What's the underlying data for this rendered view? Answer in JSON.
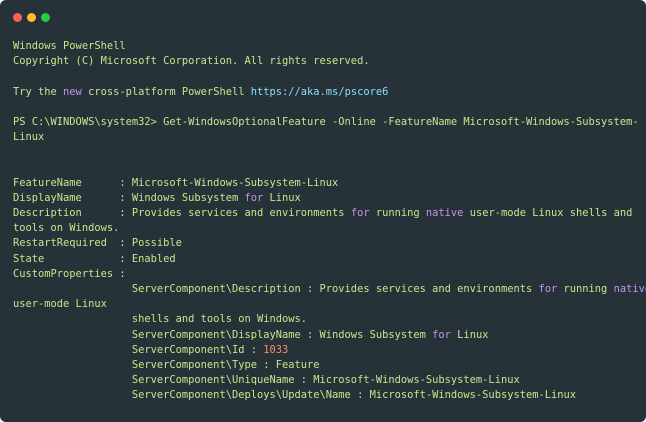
{
  "window": {
    "controls": [
      "close",
      "minimize",
      "maximize"
    ],
    "colors": {
      "background": "#263238",
      "text": "#c3e88d",
      "keyword": "#c792ea",
      "number": "#f78c6c",
      "url": "#89ddff"
    }
  },
  "terminal": {
    "lines": [
      "Windows PowerShell",
      "Copyright (C) Microsoft Corporation. All rights reserved.",
      "",
      "Try the new cross-platform PowerShell https://aka.ms/pscore6",
      "",
      "PS C:\\WINDOWS\\system32> Get-WindowsOptionalFeature -Online -FeatureName Microsoft-Windows-Subsystem-",
      "Linux",
      "",
      "",
      "FeatureName      : Microsoft-Windows-Subsystem-Linux",
      "DisplayName      : Windows Subsystem for Linux",
      "Description      : Provides services and environments for running native user-mode Linux shells and",
      "tools on Windows.",
      "RestartRequired  : Possible",
      "State            : Enabled",
      "CustomProperties :",
      "                   ServerComponent\\Description : Provides services and environments for running native",
      "user-mode Linux",
      "                   shells and tools on Windows.",
      "                   ServerComponent\\DisplayName : Windows Subsystem for Linux",
      "                   ServerComponent\\Id : 1033",
      "                   ServerComponent\\Type : Feature",
      "                   ServerComponent\\UniqueName : Microsoft-Windows-Subsystem-Linux",
      "                   ServerComponent\\Deploys\\Update\\Name : Microsoft-Windows-Subsystem-Linux"
    ]
  }
}
